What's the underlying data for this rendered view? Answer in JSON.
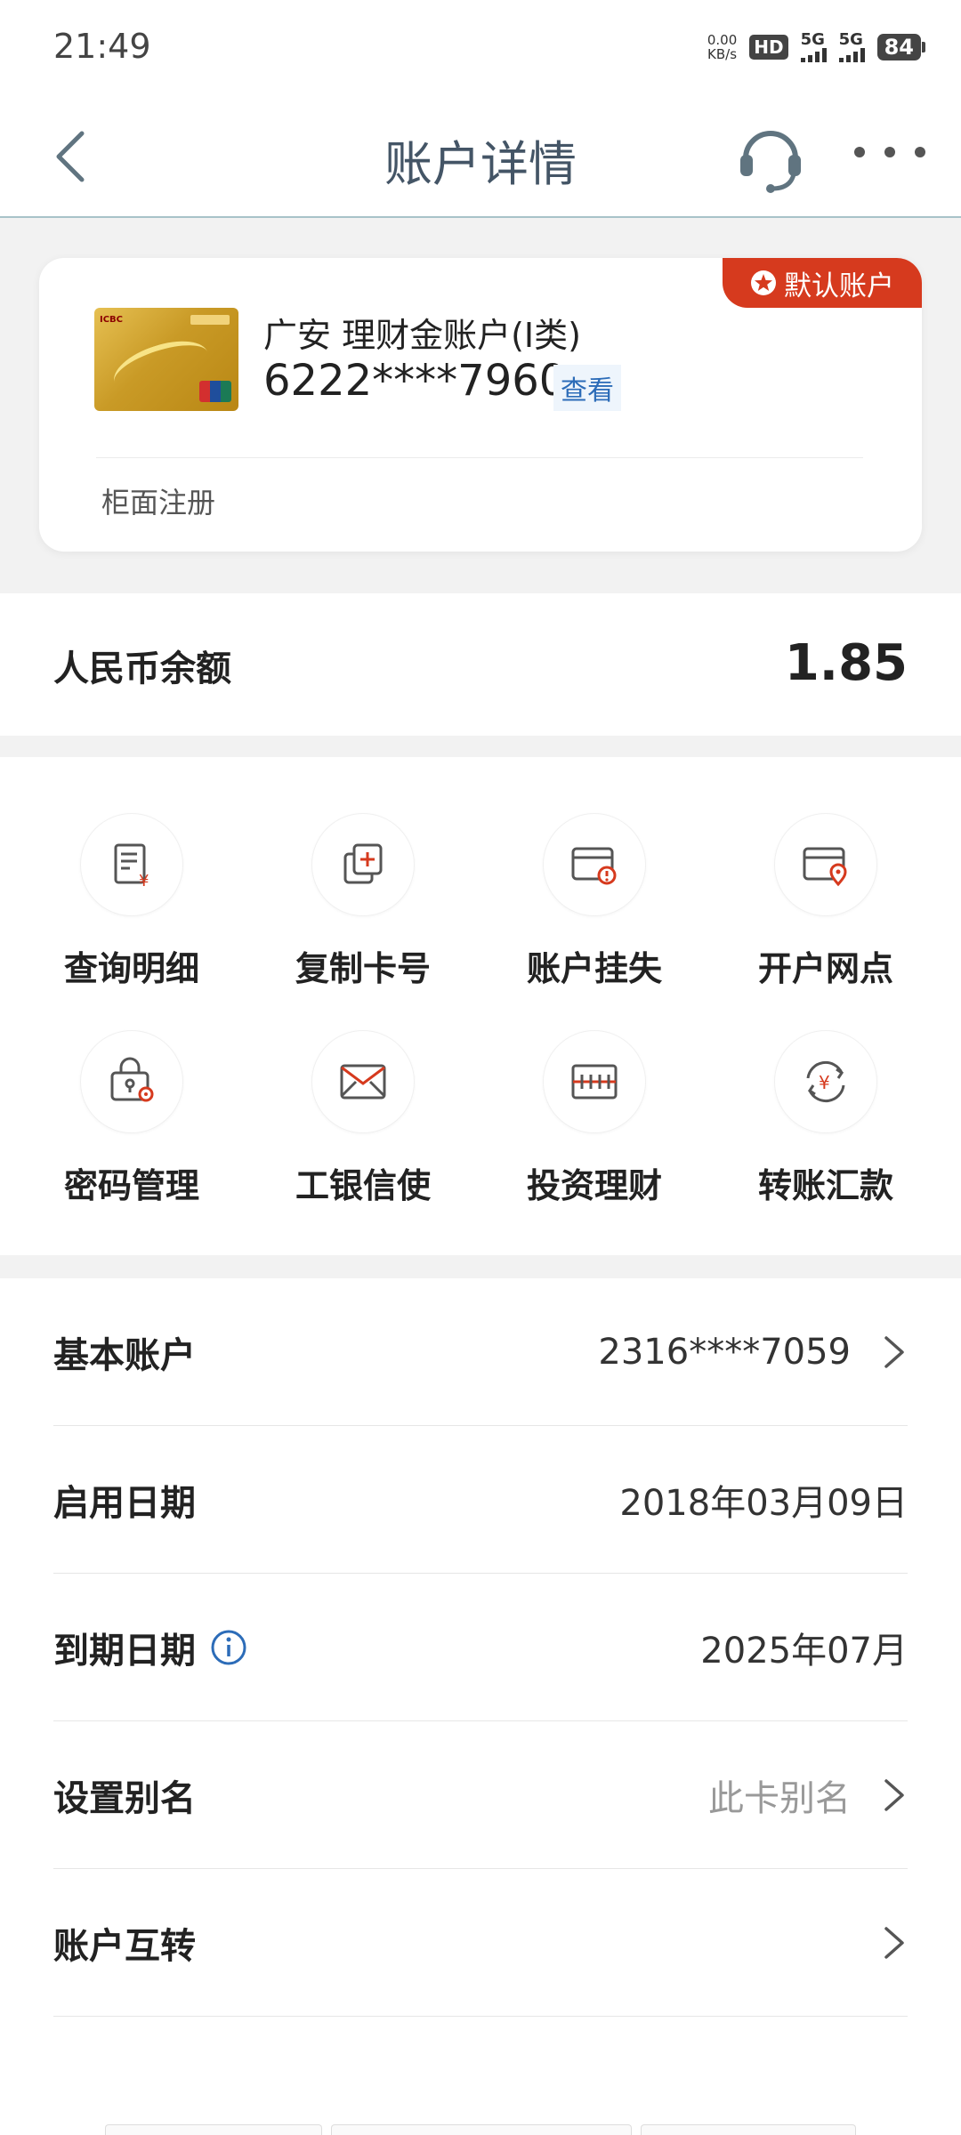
{
  "status_bar": {
    "time": "21:49",
    "net_speed": "0.00",
    "net_unit": "KB/s",
    "hd": "HD",
    "signal1": "5G",
    "signal2": "5G",
    "battery": "84"
  },
  "header": {
    "title": "账户详情"
  },
  "card": {
    "badge": "默认账户",
    "name": "广安 理财金账户(Ⅰ类)",
    "number": "6222****7960",
    "view_label": "查看",
    "registration": "柜面注册"
  },
  "balance": {
    "label": "人民币余额",
    "value": "1.85"
  },
  "actions": [
    {
      "label": "查询明细",
      "icon": "statement-icon"
    },
    {
      "label": "复制卡号",
      "icon": "copy-icon"
    },
    {
      "label": "账户挂失",
      "icon": "report-loss-icon"
    },
    {
      "label": "开户网点",
      "icon": "branch-location-icon"
    },
    {
      "label": "密码管理",
      "icon": "password-icon"
    },
    {
      "label": "工银信使",
      "icon": "envelope-icon"
    },
    {
      "label": "投资理财",
      "icon": "investment-icon"
    },
    {
      "label": "转账汇款",
      "icon": "transfer-icon"
    }
  ],
  "details": {
    "basic_account": {
      "label": "基本账户",
      "value": "2316****7059"
    },
    "start_date": {
      "label": "启用日期",
      "value": "2018年03月09日"
    },
    "expiry_date": {
      "label": "到期日期",
      "value": "2025年07月"
    },
    "alias": {
      "label": "设置别名",
      "placeholder": "此卡别名"
    },
    "transfer": {
      "label": "账户互转"
    }
  },
  "colors": {
    "accent_red": "#d63a1e",
    "link_blue": "#2c6cb8",
    "nav_divider": "#a8c3c9"
  }
}
